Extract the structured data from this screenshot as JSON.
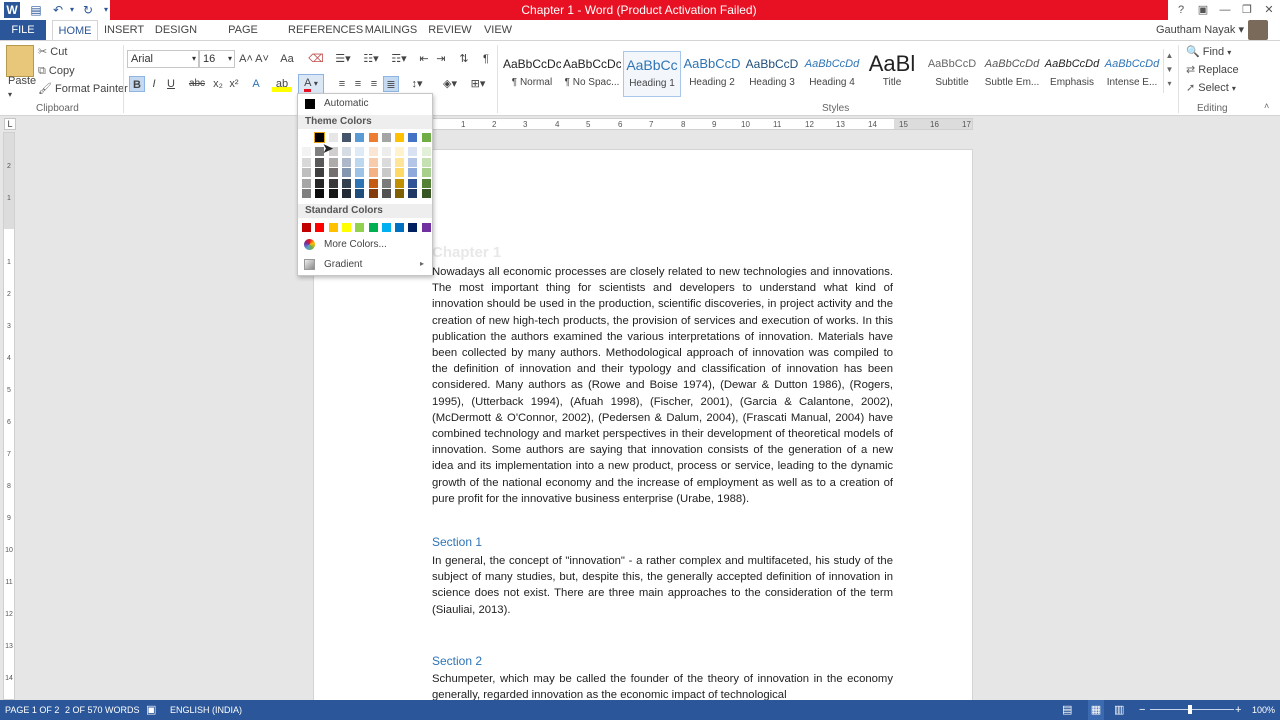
{
  "window": {
    "title": "Chapter 1 - Word (Product Activation Failed)",
    "user": "Gautham Nayak",
    "help": "?",
    "controls": [
      "▣",
      "—",
      "❐",
      "✕"
    ]
  },
  "qat": {
    "word": "W",
    "save": "💾",
    "undo": "↶",
    "redo": "↻"
  },
  "tabs": {
    "file": "FILE",
    "home": "HOME",
    "insert": "INSERT",
    "design": "DESIGN",
    "page_layout": "PAGE LAYOUT",
    "references": "REFERENCES",
    "mailings": "MAILINGS",
    "review": "REVIEW",
    "view": "VIEW"
  },
  "clipboard": {
    "paste": "Paste",
    "cut": "Cut",
    "copy": "Copy",
    "format_painter": "Format Painter",
    "label": "Clipboard"
  },
  "font": {
    "name": "Arial",
    "size": "16",
    "label": "Font",
    "bold": "B",
    "italic": "I",
    "underline": "U",
    "strike": "abc",
    "subscript": "x₂",
    "superscript": "x²",
    "grow": "A˄",
    "shrink": "A˅",
    "case": "Aa",
    "font_color": "A",
    "highlight": "ab"
  },
  "styles": {
    "label": "Styles",
    "items": [
      {
        "preview": "AaBbCcDc",
        "name": "¶ Normal"
      },
      {
        "preview": "AaBbCcDc",
        "name": "¶ No Spac..."
      },
      {
        "preview": "AaBbCc",
        "name": "Heading 1"
      },
      {
        "preview": "AaBbCcD",
        "name": "Heading 2"
      },
      {
        "preview": "AaBbCcD",
        "name": "Heading 3"
      },
      {
        "preview": "AaBbCcDd",
        "name": "Heading 4"
      },
      {
        "preview": "AaBl",
        "name": "Title"
      },
      {
        "preview": "AaBbCcD",
        "name": "Subtitle"
      },
      {
        "preview": "AaBbCcDd",
        "name": "Subtle Em..."
      },
      {
        "preview": "AaBbCcDd",
        "name": "Emphasis"
      },
      {
        "preview": "AaBbCcDd",
        "name": "Intense E..."
      }
    ]
  },
  "editing": {
    "find": "Find",
    "replace": "Replace",
    "select": "Select",
    "label": "Editing"
  },
  "ruler": {
    "h_ticks": [
      "1",
      "2",
      "3",
      "4",
      "5",
      "6",
      "7",
      "8",
      "9",
      "10",
      "11",
      "12",
      "13",
      "14",
      "15",
      "16",
      "17"
    ],
    "v_ticks": [
      "2",
      "1",
      "1",
      "2",
      "3",
      "4",
      "5",
      "6",
      "7",
      "8",
      "9",
      "10",
      "11",
      "12",
      "13",
      "14"
    ],
    "corner": "L"
  },
  "color_dropdown": {
    "automatic": "Automatic",
    "theme_colors_label": "Theme Colors",
    "standard_colors_label": "Standard Colors",
    "more_colors": "More Colors...",
    "gradient": "Gradient",
    "theme_top": [
      "#ffffff",
      "#000000",
      "#e7e6e6",
      "#44546a",
      "#5b9bd5",
      "#ed7d31",
      "#a5a5a5",
      "#ffc000",
      "#4472c4",
      "#70ad47"
    ],
    "theme_shades": [
      [
        "#f2f2f2",
        "#7f7f7f",
        "#d0cece",
        "#d6dce4",
        "#deebf6",
        "#fbe5d5",
        "#ededed",
        "#fff2cc",
        "#d9e2f3",
        "#e2efd9"
      ],
      [
        "#d8d8d8",
        "#595959",
        "#aeabab",
        "#adb9ca",
        "#bdd7ee",
        "#f7cbac",
        "#dbdbdb",
        "#fee599",
        "#b4c6e7",
        "#c5e0b3"
      ],
      [
        "#bfbfbf",
        "#3f3f3f",
        "#757070",
        "#8496b0",
        "#9cc3e5",
        "#f4b183",
        "#c9c9c9",
        "#ffd965",
        "#8eaadb",
        "#a8d08d"
      ],
      [
        "#a5a5a5",
        "#262626",
        "#3a3838",
        "#323f4f",
        "#2e75b5",
        "#c55a11",
        "#7b7b7b",
        "#bf9000",
        "#2f5496",
        "#538135"
      ],
      [
        "#7f7f7f",
        "#0c0c0c",
        "#171616",
        "#222a35",
        "#1e4e79",
        "#833c0b",
        "#525252",
        "#7f6000",
        "#1f3864",
        "#375623"
      ]
    ],
    "standard": [
      "#c00000",
      "#ff0000",
      "#ffc000",
      "#ffff00",
      "#92d050",
      "#00b050",
      "#00b0f0",
      "#0070c0",
      "#002060",
      "#7030a0"
    ]
  },
  "document": {
    "title": "Chapter 1",
    "para1": "Nowadays all economic processes are closely related to new technologies and innovations.  The most important thing for scientists and developers to understand what kind of innovation should be used in the production, scientific discoveries, in project activity and the creation of new high-tech products, the provision of services and execution of works. In this publication the authors examined the various interpretations of innovation. Materials have been collected by many authors. Methodological approach of innovation was compiled to the definition of innovation and their typology and classification of innovation has been considered. Many authors as (Rowe and Boise 1974), (Dewar & Dutton 1986), (Rogers, 1995), (Utterback 1994), (Afuah 1998), (Fischer, 2001), (Garcia & Calantone, 2002), (McDermott & O'Connor, 2002), (Pedersen & Dalum, 2004), (Frascati Manual, 2004) have combined technology and market perspectives in their development of theoretical models of innovation. Some authors are saying that innovation consists of the generation of a new idea and its implementation into a new product, process or service, leading to the dynamic growth of the national economy and the increase of employment as well as to a creation of pure profit for the innovative business enterprise (Urabe, 1988).",
    "section1": "Section 1",
    "para2": "In general, the concept of \"innovation\" - a rather complex and multifaceted, his study of the subject of many studies, but, despite this, the generally accepted definition of innovation in science does not exist. There are three main approaches to the consideration of the term (Siauliai, 2013).",
    "section2": "Section 2",
    "para3": "Schumpeter, which may be called the founder of the theory of innovation in the economy generally, regarded innovation as the economic impact of technological"
  },
  "status": {
    "page": "PAGE 1 OF 2",
    "words": "2 OF 570 WORDS",
    "language": "ENGLISH (INDIA)",
    "zoom": "100%",
    "zoom_minus": "−",
    "zoom_plus": "+"
  }
}
